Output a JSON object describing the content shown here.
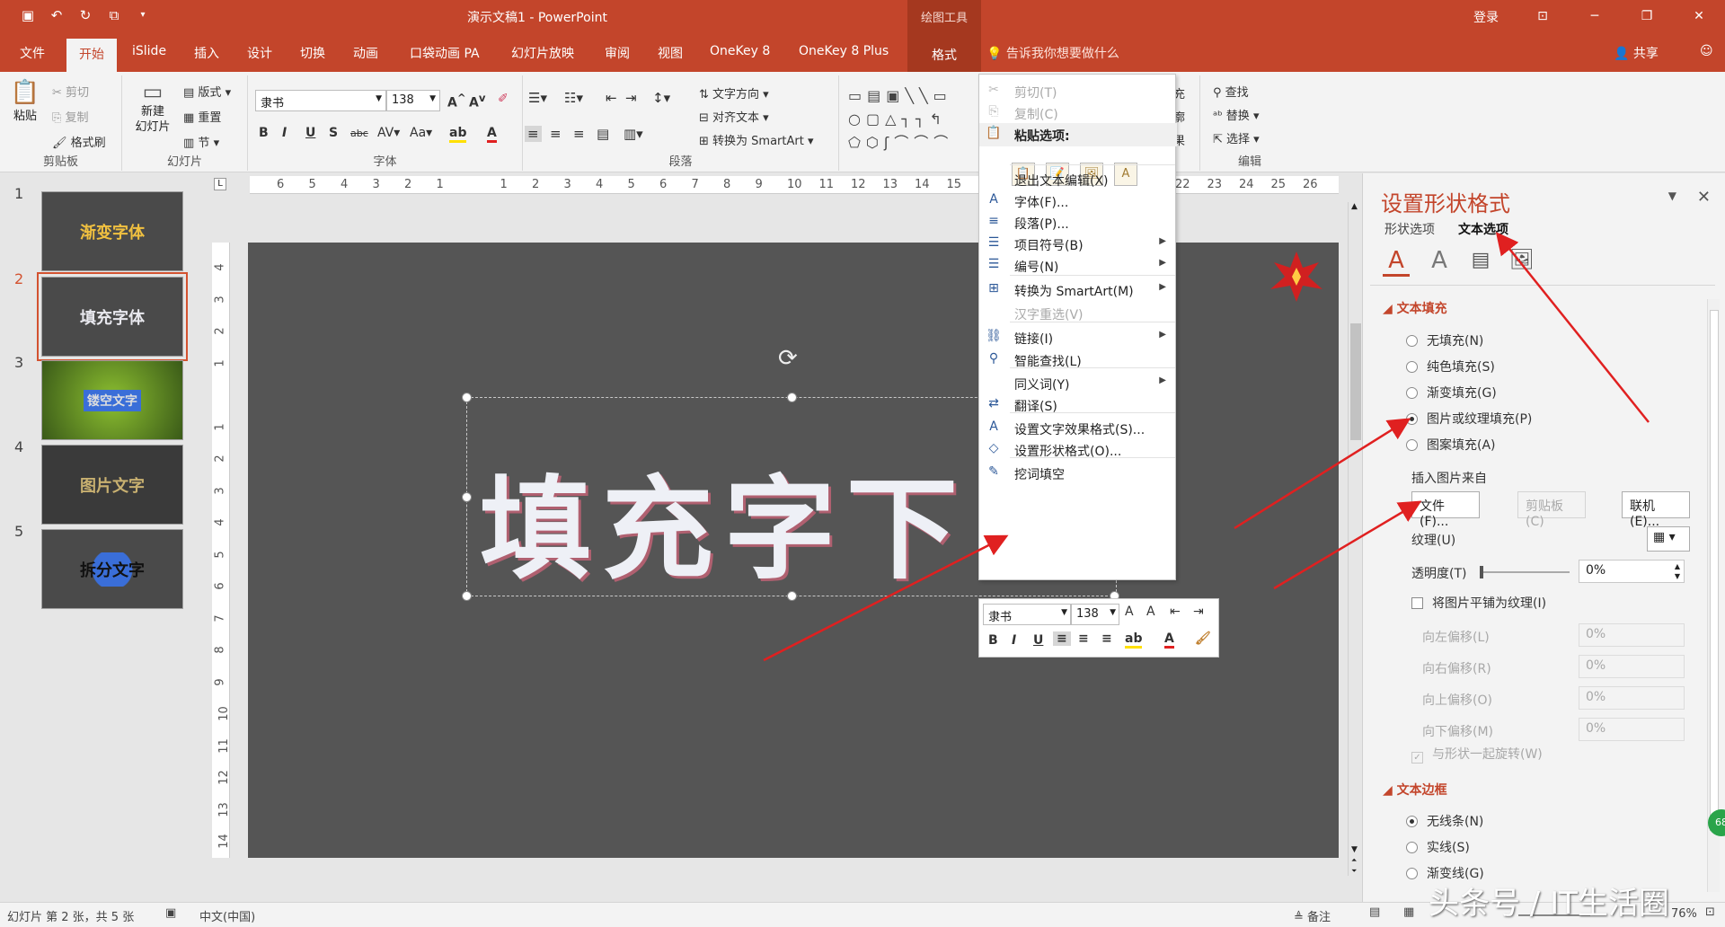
{
  "titlebar": {
    "doc_title": "演示文稿1  -  PowerPoint",
    "context_tools": "绘图工具",
    "login": "登录",
    "qat_icons": [
      "save-icon",
      "undo-icon",
      "redo-icon",
      "present-icon",
      "more-icon"
    ]
  },
  "tabs": [
    "文件",
    "开始",
    "iSlide",
    "插入",
    "设计",
    "切换",
    "动画",
    "口袋动画 PA",
    "幻灯片放映",
    "审阅",
    "视图",
    "OneKey 8",
    "OneKey 8 Plus",
    "格式"
  ],
  "tell_me": "告诉我你想要做什么",
  "share": "共享",
  "ribbon": {
    "clipboard": {
      "paste": "粘贴",
      "cut": "剪切",
      "copy": "复制",
      "painter": "格式刷",
      "label": "剪贴板"
    },
    "slides": {
      "new_slide": "新建\n幻灯片",
      "layout": "版式",
      "reset": "重置",
      "section": "节",
      "label": "幻灯片"
    },
    "font": {
      "name": "隶书",
      "size": "138",
      "label": "字体"
    },
    "paragraph": {
      "text_dir": "文字方向",
      "align_text": "对齐文本",
      "smartart": "转换为 SmartArt",
      "label": "段落"
    },
    "editing": {
      "find": "查找",
      "replace": "替换",
      "select": "选择",
      "label": "编辑"
    },
    "drawing_frag": [
      "充",
      "廓",
      "果"
    ]
  },
  "thumbnails": [
    {
      "num": "1",
      "text": "渐变字体",
      "color": "#f0c040"
    },
    {
      "num": "2",
      "text": "填充字体",
      "color": "#e8e8ee"
    },
    {
      "num": "3",
      "text": "镂空文字",
      "color": "#dddddd"
    },
    {
      "num": "4",
      "text": "图片文字",
      "color": "#c8b070"
    },
    {
      "num": "5",
      "text": "拆分文字",
      "color": "#111111"
    }
  ],
  "ruler_h": [
    "6",
    "5",
    "4",
    "3",
    "2",
    "1",
    "",
    "1",
    "2",
    "3",
    "4",
    "5",
    "6",
    "7",
    "8",
    "9",
    "10",
    "11",
    "12",
    "13",
    "14",
    "15"
  ],
  "ruler_h_right": [
    "22",
    "23",
    "24",
    "25",
    "26"
  ],
  "ruler_v": [
    "4",
    "3",
    "2",
    "1",
    "",
    "1",
    "2",
    "3",
    "4",
    "5",
    "6",
    "7",
    "8",
    "9",
    "10",
    "11",
    "12",
    "13",
    "14"
  ],
  "slide": {
    "big_text": "填充字下",
    "bg": "#555555"
  },
  "context_menu": {
    "items": [
      {
        "icon": "✂",
        "label": "剪切(T)",
        "disabled": true
      },
      {
        "icon": "⎘",
        "label": "复制(C)",
        "disabled": true
      },
      {
        "icon": "📋",
        "label": "粘贴选项:",
        "header": true
      },
      {
        "icon": "",
        "label": "退出文本编辑(X)"
      },
      {
        "icon": "A",
        "label": "字体(F)..."
      },
      {
        "icon": "≡",
        "label": "段落(P)..."
      },
      {
        "icon": "☰",
        "label": "项目符号(B)",
        "arrow": true
      },
      {
        "icon": "☰",
        "label": "编号(N)",
        "arrow": true
      },
      {
        "icon": "⊞",
        "label": "转换为 SmartArt(M)",
        "arrow": true
      },
      {
        "icon": "",
        "label": "汉字重选(V)",
        "disabled": true
      },
      {
        "icon": "⛓",
        "label": "链接(I)",
        "arrow": true
      },
      {
        "icon": "⚲",
        "label": "智能查找(L)"
      },
      {
        "icon": "",
        "label": "同义词(Y)",
        "arrow": true
      },
      {
        "icon": "⇄",
        "label": "翻译(S)"
      },
      {
        "icon": "A",
        "label": "设置文字效果格式(S)..."
      },
      {
        "icon": "◇",
        "label": "设置形状格式(O)..."
      },
      {
        "icon": "✎",
        "label": "挖词填空"
      }
    ]
  },
  "mini_toolbar": {
    "font": "隶书",
    "size": "138"
  },
  "format_pane": {
    "title": "设置形状格式",
    "tab_shape": "形状选项",
    "tab_text": "文本选项",
    "section_fill": "文本填充",
    "fill_options": [
      "无填充(N)",
      "纯色填充(S)",
      "渐变填充(G)",
      "图片或纹理填充(P)",
      "图案填充(A)"
    ],
    "fill_selected": 3,
    "insert_from": "插入图片来自",
    "btn_file": "文件(F)...",
    "btn_clipboard": "剪贴板(C)",
    "btn_online": "联机(E)...",
    "texture": "纹理(U)",
    "transparency_label": "透明度(T)",
    "transparency": "0%",
    "tile": "将图片平铺为纹理(I)",
    "offsets": [
      {
        "label": "向左偏移(L)",
        "value": "0%"
      },
      {
        "label": "向右偏移(R)",
        "value": "0%"
      },
      {
        "label": "向上偏移(O)",
        "value": "0%"
      },
      {
        "label": "向下偏移(M)",
        "value": "0%"
      }
    ],
    "rotate_with": "与形状一起旋转(W)",
    "section_outline": "文本边框",
    "outline_options": [
      "无线条(N)",
      "实线(S)",
      "渐变线(G)"
    ],
    "outline_selected": 0,
    "badge": "68"
  },
  "status": {
    "slide_info": "幻灯片 第 2 张，共 5 张",
    "lang": "中文(中国)",
    "notes": "备注",
    "zoom": "76%"
  },
  "watermark": "头条号 / IT生活圈",
  "colors": {
    "accent": "#c3452b",
    "arrow": "#e02020"
  }
}
